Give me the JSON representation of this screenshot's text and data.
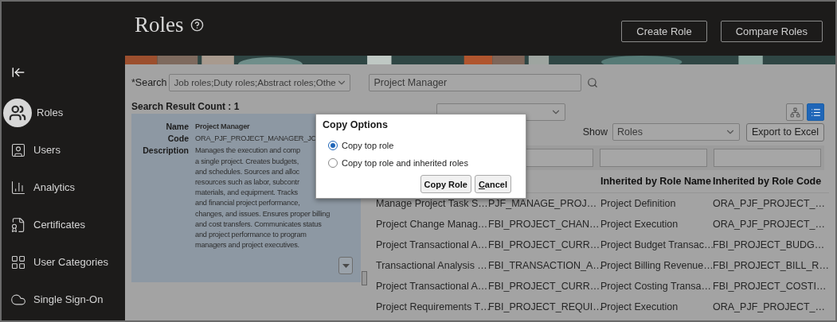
{
  "page_title": "Roles",
  "header_buttons": [
    "Create Role",
    "Compare Roles"
  ],
  "sidebar": {
    "items": [
      {
        "label": "Roles",
        "selected": true
      },
      {
        "label": "Users",
        "selected": false
      },
      {
        "label": "Analytics",
        "selected": false
      },
      {
        "label": "Certificates",
        "selected": false
      },
      {
        "label": "User Categories",
        "selected": false
      },
      {
        "label": "Single Sign-On",
        "selected": false
      }
    ]
  },
  "search": {
    "label": "*Search",
    "scope": "Job roles;Duty roles;Abstract roles;Othe",
    "query": "Project Manager"
  },
  "result_count": "Search Result Count : 1",
  "result_card": {
    "fields": [
      {
        "label": "Name",
        "lines": [
          "Project Manager"
        ]
      },
      {
        "label": "Code",
        "lines": [
          "ORA_PJF_PROJECT_MANAGER_JC"
        ]
      },
      {
        "label": "Description",
        "lines": [
          "Manages the execution and comp",
          "a single project. Creates budgets,",
          "and schedules. Sources and alloc",
          "resources such as labor, subcontr",
          "materials, and equipment. Tracks",
          "and financial project performance,",
          "changes, and issues. Ensures proper billing",
          "and cost transfers. Communicates status",
          "and project performance to program",
          "managers and project executives."
        ]
      }
    ]
  },
  "view_buttons": [
    {
      "selected": false
    },
    {
      "selected": true
    }
  ],
  "show": {
    "label": "Show",
    "value": "Roles"
  },
  "export_button": "Export to Excel",
  "table": {
    "column_headers": {
      "column_3": "Inherited by Role Name",
      "column_4": "Inherited by Role Code"
    },
    "rows": [
      [
        "Manage Project Task S…",
        "PJF_MANAGE_PROJ…",
        "Project Definition",
        "ORA_PJF_PROJECT_…"
      ],
      [
        "Project Change Manag…",
        "FBI_PROJECT_CHAN…",
        "Project Execution",
        "ORA_PJF_PROJECT_…"
      ],
      [
        "Project Transactional A…",
        "FBI_PROJECT_CURR…",
        "Project Budget Transac…",
        "FBI_PROJECT_BUDG…"
      ],
      [
        "Transactional Analysis …",
        "FBI_TRANSACTION_A…",
        "Project Billing Revenue…",
        "FBI_PROJECT_BILL_R…"
      ],
      [
        "Project Transactional A…",
        "FBI_PROJECT_CURR…",
        "Project Costing Transa…",
        "FBI_PROJECT_COSTI…"
      ],
      [
        "Project Requirements T…",
        "FBI_PROJECT_REQUI…",
        "Project Execution",
        "ORA_PJF_PROJECT_…"
      ]
    ]
  },
  "dialog": {
    "title": "Copy Options",
    "options": [
      {
        "label": "Copy top role",
        "selected": true
      },
      {
        "label": "Copy top role and inherited roles",
        "selected": false
      }
    ],
    "buttons": [
      {
        "label": "Copy Role",
        "mnemonic": false
      },
      {
        "label": "Cancel",
        "mnemonic": true
      }
    ]
  }
}
